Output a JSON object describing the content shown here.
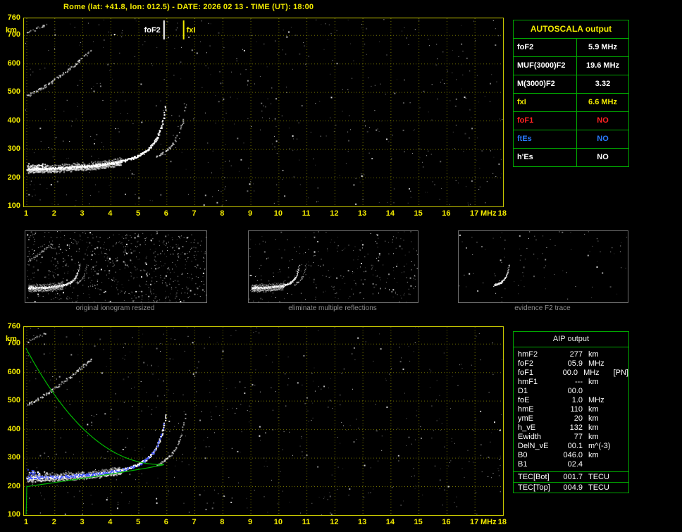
{
  "title": "Rome (lat: +41.8, lon: 012.5) - DATE: 2026 02 13 - TIME (UT): 18:00",
  "colors": {
    "accent_yellow": "#f2ea00",
    "grid_yellow": "#9c9c00",
    "table_green": "#00a800",
    "status_red": "#ff2222",
    "status_blue": "#2a7bff",
    "profile_green": "#00c000",
    "restored_blue": "#3c50ff"
  },
  "main_ionogram": {
    "y_unit": "km",
    "x_unit": "MHz",
    "y_ticks": [
      760,
      700,
      600,
      500,
      400,
      300,
      200,
      100
    ],
    "x_ticks": [
      1,
      2,
      3,
      4,
      5,
      6,
      7,
      8,
      9,
      10,
      11,
      12,
      13,
      14,
      15,
      16,
      17,
      18
    ]
  },
  "restored_ionogram": {
    "y_unit": "km",
    "x_unit": "MHz",
    "y_ticks": [
      760,
      700,
      600,
      500,
      400,
      300,
      200,
      100
    ],
    "x_ticks": [
      1,
      2,
      3,
      4,
      5,
      6,
      7,
      8,
      9,
      10,
      11,
      12,
      13,
      14,
      15,
      16,
      17,
      18
    ]
  },
  "autoscala": {
    "header": "AUTOSCALA output",
    "rows": [
      {
        "label": "foF2",
        "value": "5.9 MHz",
        "color": "#ffffff"
      },
      {
        "label": "MUF(3000)F2",
        "value": "19.6 MHz",
        "color": "#ffffff"
      },
      {
        "label": "M(3000)F2",
        "value": "3.32",
        "color": "#ffffff"
      },
      {
        "label": "fxI",
        "value": "6.6 MHz",
        "color": "#f2ea00"
      },
      {
        "label": "foF1",
        "value": "NO",
        "color": "#ff2222"
      },
      {
        "label": "ftEs",
        "value": "NO",
        "color": "#2a7bff"
      },
      {
        "label": "h'Es",
        "value": "NO",
        "color": "#ffffff"
      }
    ]
  },
  "thumbnails": [
    {
      "caption": "original ionogram resized"
    },
    {
      "caption": "eliminate multiple reflections"
    },
    {
      "caption": "evidence F2 trace"
    }
  ],
  "aip": {
    "header": "AIP output",
    "rows": [
      {
        "label": "hmF2",
        "value": "277",
        "unit": "km",
        "extra": ""
      },
      {
        "label": "foF2",
        "value": "05.9",
        "unit": "MHz",
        "extra": ""
      },
      {
        "label": "foF1",
        "value": "00.0",
        "unit": "MHz",
        "extra": "[PN]"
      },
      {
        "label": "hmF1",
        "value": "---",
        "unit": "km",
        "extra": ""
      },
      {
        "label": "D1",
        "value": "00.0",
        "unit": "",
        "extra": ""
      },
      {
        "label": "foE",
        "value": "1.0",
        "unit": "MHz",
        "extra": ""
      },
      {
        "label": "hmE",
        "value": "110",
        "unit": "km",
        "extra": ""
      },
      {
        "label": "ymE",
        "value": "20",
        "unit": "km",
        "extra": ""
      },
      {
        "label": "h_vE",
        "value": "132",
        "unit": "km",
        "extra": ""
      },
      {
        "label": "Ewidth",
        "value": "77",
        "unit": "km",
        "extra": ""
      },
      {
        "label": "DelN_vE",
        "value": "00.1",
        "unit": "m^(-3)",
        "extra": ""
      },
      {
        "label": "B0",
        "value": "046.0",
        "unit": "km",
        "extra": ""
      },
      {
        "label": "B1",
        "value": "02.4",
        "unit": "",
        "extra": ""
      }
    ],
    "tec_rows": [
      {
        "label": "TEC[Bot]",
        "value": "001.7",
        "unit": "TECU"
      },
      {
        "label": "TEC[Top]",
        "value": "004.9",
        "unit": "TECU"
      }
    ]
  },
  "chart_data": [
    {
      "type": "scatter",
      "name": "main ionogram (virtual height vs sounding frequency)",
      "xlabel": "MHz",
      "ylabel": "km",
      "xlim": [
        1,
        18
      ],
      "ylim": [
        100,
        760
      ],
      "x_ticks": [
        1,
        2,
        3,
        4,
        5,
        6,
        7,
        8,
        9,
        10,
        11,
        12,
        13,
        14,
        15,
        16,
        17,
        18
      ],
      "y_ticks": [
        760,
        700,
        600,
        500,
        400,
        300,
        200,
        100
      ],
      "grid": "dotted yellow every 1 MHz / 100 km",
      "markers": [
        {
          "label": "foF2",
          "freq_MHz": 5.9,
          "color": "#ffffff"
        },
        {
          "label": "fxI",
          "freq_MHz": 6.6,
          "color": "#f2ea00"
        }
      ],
      "series_note": "white echo trace: F-region trace flat near 235 km from 1-5 MHz rising asymptotically to ~460 km at foF2 5.9 MHz (x-branch near fxI 6.6 MHz); 2nd multiple ~480-650 km up to ~4.5 MHz; 3rd multiple ~700 km below 2 MHz; random speckle noise background"
    },
    {
      "type": "scatter",
      "name": "restored ionogram with fitted trace and electron density profile",
      "xlabel": "MHz",
      "ylabel": "km",
      "xlim": [
        1,
        18
      ],
      "ylim": [
        100,
        760
      ],
      "profile": {
        "color": "#00c000",
        "hmF2_km": 277,
        "foF2_MHz": 5.9,
        "bottom_km": 200,
        "topside_reaches_km": 690,
        "hmE_km": 110
      },
      "restored_trace": {
        "color": "#3c50ff",
        "follows": "first-hop echo trace 1-5.9 MHz"
      },
      "series_note": "same white echo traces as main ionogram plus blue restored trace and green N(h) profile"
    }
  ]
}
